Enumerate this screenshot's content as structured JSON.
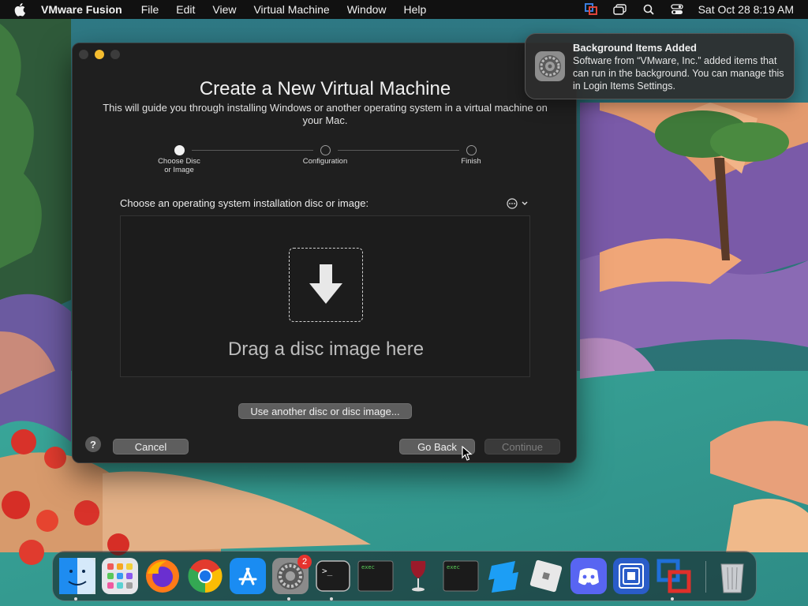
{
  "menubar": {
    "app_name": "VMware Fusion",
    "menus": [
      "File",
      "Edit",
      "View",
      "Virtual Machine",
      "Window",
      "Help"
    ],
    "clock": "Sat Oct 28  8:19 AM"
  },
  "window": {
    "title": "Create a New Virtual Machine",
    "subtitle": "This will guide you through installing Windows or another operating system in a virtual machine on your Mac.",
    "steps": [
      {
        "label": "Choose Disc\nor Image",
        "active": true
      },
      {
        "label": "Configuration",
        "active": false
      },
      {
        "label": "Finish",
        "active": false
      }
    ],
    "choose_label": "Choose an operating system installation disc or image:",
    "drop_text": "Drag a disc image here",
    "use_another_button": "Use another disc or disc image...",
    "help_button": "?",
    "cancel_button": "Cancel",
    "go_back_button": "Go Back",
    "continue_button": "Continue"
  },
  "notification": {
    "title": "Background Items Added",
    "body": "Software from “VMware, Inc.” added items that can run in the background. You can manage this in Login Items Settings."
  },
  "dock": {
    "items": [
      {
        "name": "finder-icon",
        "running": true
      },
      {
        "name": "launchpad-icon",
        "running": false
      },
      {
        "name": "firefox-icon",
        "running": false
      },
      {
        "name": "chrome-icon",
        "running": false
      },
      {
        "name": "app-store-icon",
        "running": false
      },
      {
        "name": "system-settings-icon",
        "running": true,
        "badge": "2"
      },
      {
        "name": "terminal-icon",
        "running": true
      },
      {
        "name": "exec-icon",
        "running": false
      },
      {
        "name": "wine-icon",
        "running": false
      },
      {
        "name": "exec-icon",
        "running": false
      },
      {
        "name": "roblox-studio-icon",
        "running": false
      },
      {
        "name": "roblox-icon",
        "running": false
      },
      {
        "name": "discord-icon",
        "running": false
      },
      {
        "name": "vnc-icon",
        "running": false
      },
      {
        "name": "vmware-fusion-icon",
        "running": true
      },
      {
        "name": "trash-icon",
        "running": false
      }
    ],
    "exec_label": "exec"
  },
  "colors": {
    "accent": "#f5bd2f",
    "badge": "#e5322d"
  }
}
